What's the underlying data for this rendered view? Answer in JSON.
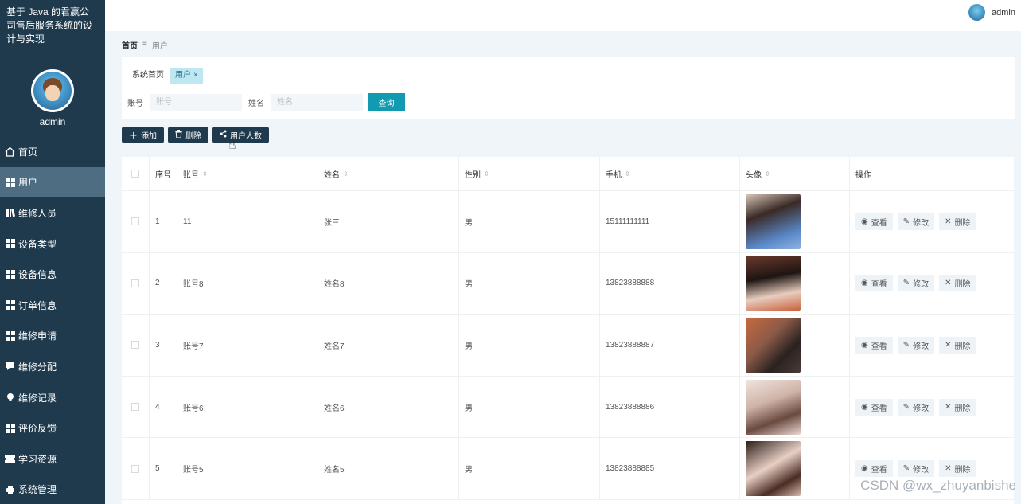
{
  "app": {
    "title": "基于 Java 的君赢公司售后服务系统的设计与实现"
  },
  "sidebar": {
    "username": "admin",
    "items": [
      {
        "label": "首页",
        "icon": "home-icon"
      },
      {
        "label": "用户",
        "icon": "grid-icon",
        "active": true
      },
      {
        "label": "维修人员",
        "icon": "book-icon"
      },
      {
        "label": "设备类型",
        "icon": "grid-icon"
      },
      {
        "label": "设备信息",
        "icon": "grid-icon"
      },
      {
        "label": "订单信息",
        "icon": "grid-icon"
      },
      {
        "label": "维修申请",
        "icon": "grid-icon"
      },
      {
        "label": "维修分配",
        "icon": "chat-icon"
      },
      {
        "label": "维修记录",
        "icon": "bulb-icon"
      },
      {
        "label": "评价反馈",
        "icon": "grid-icon"
      },
      {
        "label": "学习资源",
        "icon": "ticket-icon"
      },
      {
        "label": "系统管理",
        "icon": "printer-icon"
      }
    ]
  },
  "topbar": {
    "username": "admin"
  },
  "breadcrumb": {
    "home": "首页",
    "separator": "≡",
    "current": "用户"
  },
  "tabs": [
    {
      "label": "系统首页"
    },
    {
      "label": "用户",
      "close": "×"
    }
  ],
  "search": {
    "account_label": "账号",
    "account_placeholder": "账号",
    "name_label": "姓名",
    "name_placeholder": "姓名",
    "button": "查询"
  },
  "actions": {
    "add": "添加",
    "delete": "删除",
    "stats": "用户人数"
  },
  "table": {
    "headers": [
      "序号",
      "账号",
      "姓名",
      "性别",
      "手机",
      "头像",
      "操作"
    ],
    "rows": [
      {
        "no": "1",
        "account": "11",
        "name": "张三",
        "gender": "男",
        "phone": "15111111111"
      },
      {
        "no": "2",
        "account": "账号8",
        "name": "姓名8",
        "gender": "男",
        "phone": "13823888888"
      },
      {
        "no": "3",
        "account": "账号7",
        "name": "姓名7",
        "gender": "男",
        "phone": "13823888887"
      },
      {
        "no": "4",
        "account": "账号6",
        "name": "姓名6",
        "gender": "男",
        "phone": "13823888886"
      },
      {
        "no": "5",
        "account": "账号5",
        "name": "姓名5",
        "gender": "男",
        "phone": "13823888885"
      }
    ],
    "ops": {
      "view": "查看",
      "edit": "修改",
      "delete": "删除"
    }
  },
  "watermark": "CSDN @wx_zhuyanbishe",
  "colors": {
    "sidebar": "#1f3a4d",
    "accent": "#129bb0",
    "active_tab": "#bfe7f2"
  }
}
